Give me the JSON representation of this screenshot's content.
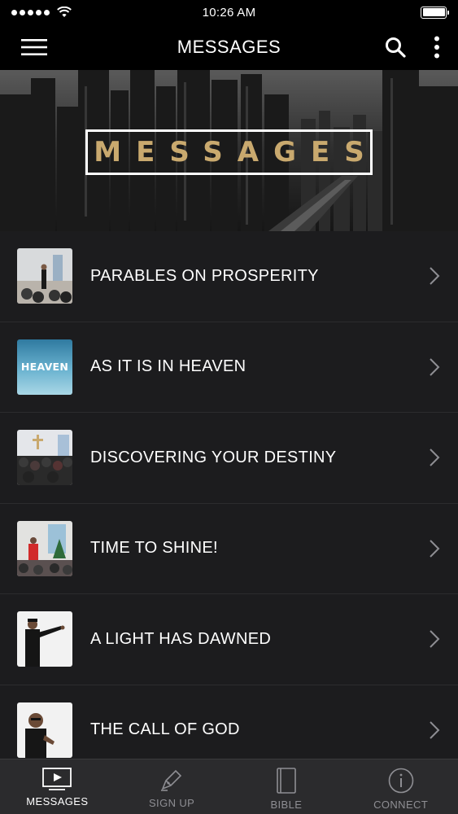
{
  "status_bar": {
    "time": "10:26 AM"
  },
  "nav": {
    "title": "MESSAGES"
  },
  "hero": {
    "title": "MESSAGES"
  },
  "messages": [
    {
      "title": "PARABLES ON PROSPERITY"
    },
    {
      "title": "AS IT IS IN HEAVEN",
      "thumb_text": "HEAVEN"
    },
    {
      "title": "DISCOVERING YOUR DESTINY"
    },
    {
      "title": "TIME TO SHINE!"
    },
    {
      "title": "A LIGHT HAS DAWNED"
    },
    {
      "title": "THE CALL OF GOD"
    }
  ],
  "tabs": [
    {
      "label": "MESSAGES",
      "icon": "video-icon",
      "active": true
    },
    {
      "label": "SIGN UP",
      "icon": "pen-icon",
      "active": false
    },
    {
      "label": "BIBLE",
      "icon": "book-icon",
      "active": false
    },
    {
      "label": "CONNECT",
      "icon": "info-icon",
      "active": false
    }
  ],
  "colors": {
    "accent_gold": "#c9a96e",
    "background": "#1c1c1e",
    "bar": "#000000",
    "tab_inactive": "#8e8e93"
  }
}
